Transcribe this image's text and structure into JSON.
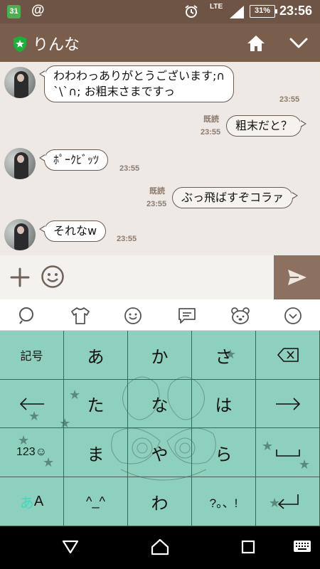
{
  "status_bar": {
    "calendar_day": "31",
    "at_sign": "@",
    "network": "LTE",
    "battery": "31%",
    "time": "23:56"
  },
  "header": {
    "contact_name": "りんな"
  },
  "messages": [
    {
      "side": "left",
      "lines": [
        "わわわっありがとうございます;∩",
        "`\\`∩; お粗末さまですっ"
      ],
      "time": "23:55"
    },
    {
      "side": "right",
      "text": "粗末だと？",
      "read": "既読",
      "time": "23:55"
    },
    {
      "side": "left",
      "text": "ﾎﾟｰｸﾋﾞｯﾂ",
      "time": "23:55"
    },
    {
      "side": "right",
      "text": "ぶっ飛ばすぞコラァ",
      "read": "既読",
      "time": "23:55"
    },
    {
      "side": "left",
      "text": "それなw",
      "time": "23:55"
    }
  ],
  "input": {
    "value": ""
  },
  "keyboard_toolbar": {
    "icons": [
      "search-icon",
      "shirt-icon",
      "smiley-icon",
      "chat-bubble-icon",
      "bear-face-icon",
      "collapse-icon"
    ]
  },
  "keyboard": {
    "rows": [
      [
        "記号",
        "あ",
        "か",
        "さ",
        "⌫"
      ],
      [
        "←",
        "た",
        "な",
        "は",
        "→"
      ],
      [
        "123☺",
        "ま",
        "や",
        "ら",
        "␣"
      ],
      [
        "あA",
        "^_^",
        "わ",
        "?。、!",
        "↵"
      ]
    ],
    "mode_kana": "あ",
    "mode_alpha": "A",
    "accent_color": "#8dd0bd"
  },
  "colors": {
    "brand_brown": "#7a5e4c",
    "chat_bg": "#eee9e4"
  }
}
